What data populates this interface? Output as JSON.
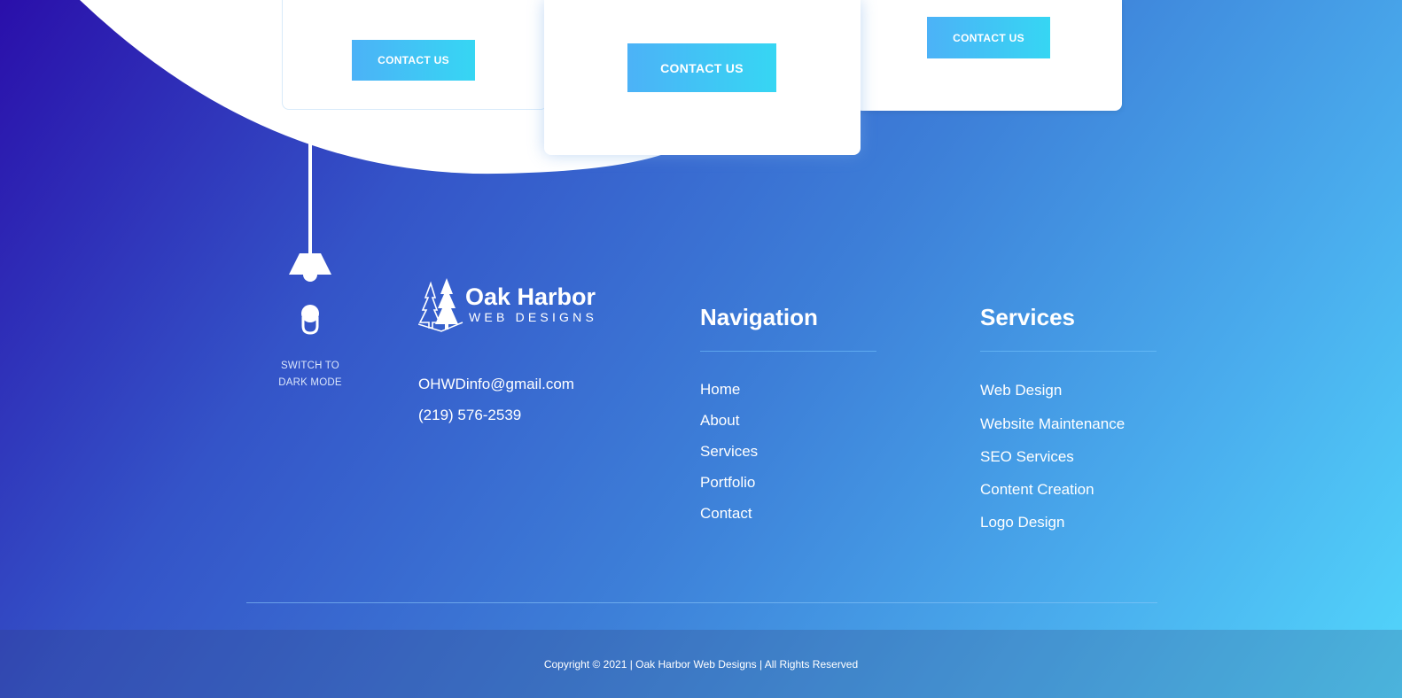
{
  "cards": {
    "left_button": "CONTACT US",
    "middle_button": "CONTACT US",
    "right_button": "CONTACT US"
  },
  "theme_toggle": {
    "label_line1": "SWITCH TO",
    "label_line2": "DARK MODE",
    "icon": "lamp-icon"
  },
  "brand": {
    "name": "Oak Harbor",
    "tagline": "WEB DESIGNS",
    "logo_icon": "pine-trees-icon"
  },
  "contact": {
    "email": "OHWDinfo@gmail.com",
    "phone": "(219) 576-2539"
  },
  "navigation": {
    "title": "Navigation",
    "items": [
      "Home",
      "About",
      "Services",
      "Portfolio",
      "Contact"
    ]
  },
  "services": {
    "title": "Services",
    "items": [
      "Web Design",
      "Website Maintenance",
      "SEO Services",
      "Content Creation",
      "Logo Design"
    ]
  },
  "footer": {
    "copyright": "Copyright © 2021 | Oak Harbor Web Designs | All Rights Reserved"
  },
  "colors": {
    "gradient_start": "#2a0faa",
    "gradient_end": "#52d6fb",
    "button_start": "#4cb2f7",
    "button_end": "#36d6f3"
  }
}
